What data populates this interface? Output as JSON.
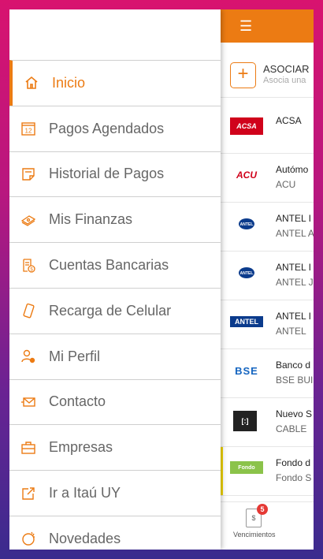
{
  "colors": {
    "accent": "#ec7b13",
    "background_top": "#d8136f",
    "background_bottom": "#3a2b8e"
  },
  "drawer": {
    "items": [
      {
        "label": "Inicio",
        "icon": "home-icon",
        "active": true
      },
      {
        "label": "Pagos Agendados",
        "icon": "calendar-icon"
      },
      {
        "label": "Historial de Pagos",
        "icon": "history-icon"
      },
      {
        "label": "Mis Finanzas",
        "icon": "finance-icon"
      },
      {
        "label": "Cuentas Bancarias",
        "icon": "bank-account-icon"
      },
      {
        "label": "Recarga de Celular",
        "icon": "phone-icon"
      },
      {
        "label": "Mi Perfil",
        "icon": "profile-icon"
      },
      {
        "label": "Contacto",
        "icon": "mail-icon"
      },
      {
        "label": "Empresas",
        "icon": "briefcase-icon"
      },
      {
        "label": "Ir a Itaú UY",
        "icon": "external-link-icon"
      },
      {
        "label": "Novedades",
        "icon": "news-icon"
      }
    ],
    "calendar_day": "12"
  },
  "app": {
    "menu_icon": "☰",
    "associate": {
      "plus": "+",
      "title": "ASOCIAR",
      "subtitle": "Asocia una"
    },
    "businesses": [
      {
        "logo": "ACSA",
        "name": "ACSA",
        "sub": ""
      },
      {
        "logo": "ACU",
        "name": "Autómo",
        "sub": "ACU"
      },
      {
        "logo": "ANTEL",
        "name": "ANTEL I",
        "sub": "ANTEL A"
      },
      {
        "logo": "ANTEL",
        "name": "ANTEL I",
        "sub": "ANTEL J"
      },
      {
        "logo": "ANTEL",
        "name": "ANTEL I",
        "sub": "ANTEL"
      },
      {
        "logo": "BSE",
        "name": "Banco d",
        "sub": "BSE BUI"
      },
      {
        "logo": "[:]",
        "name": "Nuevo S",
        "sub": "CABLE"
      },
      {
        "logo": "Fondo",
        "name": "Fondo d",
        "sub": "Fondo S"
      }
    ],
    "bottom_nav": {
      "label": "Vencimientos",
      "badge": "5",
      "icon_text": "$"
    }
  }
}
